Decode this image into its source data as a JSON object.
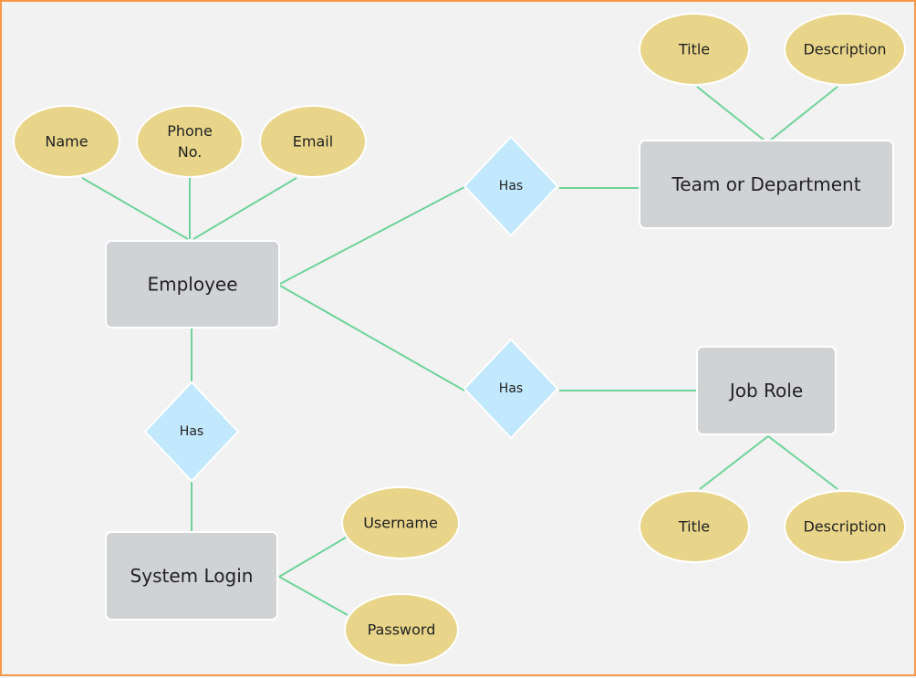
{
  "diagram": {
    "type": "entity-relationship",
    "colors": {
      "border": "#f7994a",
      "background": "#f2f2f2",
      "entity_fill": "#d1d2d4",
      "attribute_fill": "#e8d58a",
      "relationship_fill": "#c2e8fd",
      "connector": "#6ed39a",
      "outline": "#ffffff",
      "text": "#222222"
    },
    "entities": [
      {
        "id": "employee",
        "label": "Employee"
      },
      {
        "id": "team",
        "label": "Team or Department"
      },
      {
        "id": "jobrole",
        "label": "Job Role"
      },
      {
        "id": "login",
        "label": "System Login"
      }
    ],
    "relationships": [
      {
        "id": "has_team",
        "label": "Has",
        "from": "employee",
        "to": "team"
      },
      {
        "id": "has_role",
        "label": "Has",
        "from": "employee",
        "to": "jobrole"
      },
      {
        "id": "has_login",
        "label": "Has",
        "from": "employee",
        "to": "login"
      }
    ],
    "attributes": [
      {
        "id": "emp_name",
        "entity": "employee",
        "lines": [
          "Name"
        ]
      },
      {
        "id": "emp_phone",
        "entity": "employee",
        "lines": [
          "Phone",
          "No."
        ]
      },
      {
        "id": "emp_email",
        "entity": "employee",
        "lines": [
          "Email"
        ]
      },
      {
        "id": "team_title",
        "entity": "team",
        "lines": [
          "Title"
        ]
      },
      {
        "id": "team_desc",
        "entity": "team",
        "lines": [
          "Description"
        ]
      },
      {
        "id": "role_title",
        "entity": "jobrole",
        "lines": [
          "Title"
        ]
      },
      {
        "id": "role_desc",
        "entity": "jobrole",
        "lines": [
          "Description"
        ]
      },
      {
        "id": "login_user",
        "entity": "login",
        "lines": [
          "Username"
        ]
      },
      {
        "id": "login_pass",
        "entity": "login",
        "lines": [
          "Password"
        ]
      }
    ]
  }
}
